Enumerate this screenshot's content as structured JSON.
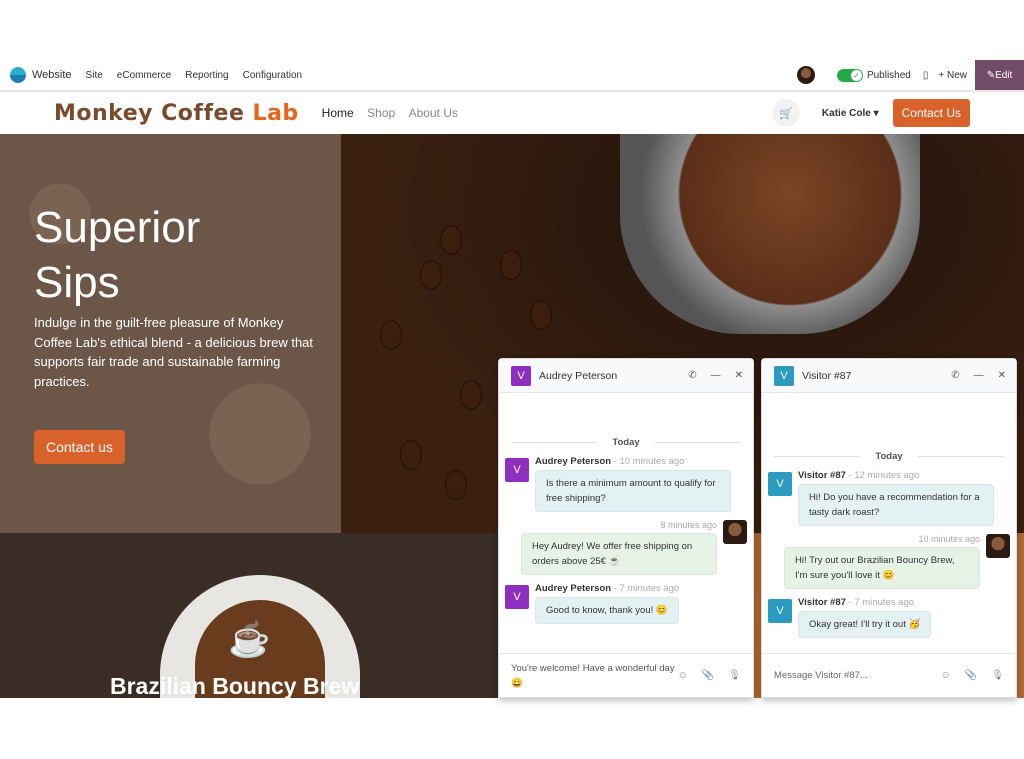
{
  "toolbar": {
    "app": "Website",
    "menu": [
      "Site",
      "eCommerce",
      "Reporting",
      "Configuration"
    ],
    "published": "Published",
    "new": "+ New",
    "edit": "Edit"
  },
  "site": {
    "brand_a": "Monkey ",
    "brand_b": "Coffee ",
    "brand_c": "Lab",
    "nav": [
      "Home",
      "Shop",
      "About Us"
    ],
    "user": "Katie Cole",
    "contact": "Contact Us"
  },
  "hero": {
    "title_1": "Superior",
    "title_2": "Sips",
    "text": "Indulge in the guilt-free pleasure of Monkey Coffee Lab's ethical blend - a delicious brew that supports fair trade and sustainable farming practices.",
    "button": "Contact us"
  },
  "product": {
    "title": "Brazilian Bouncy Brew"
  },
  "chat1": {
    "avatar": "V",
    "color": "#8e2fbf",
    "name": "Audrey Peterson",
    "today": "Today",
    "m1": {
      "who": "Audrey Peterson",
      "time": "- 10 minutes ago",
      "text": "Is there a minimum amount to qualify for free shipping?"
    },
    "m2": {
      "time": "8 minutes ago",
      "text": "Hey Audrey! We offer free shipping on orders above 25€ ☕"
    },
    "m3": {
      "who": "Audrey Peterson",
      "time": "- 7 minutes ago",
      "text": "Good to know, thank you! 😊"
    },
    "input": "You're welcome! Have a wonderful day 😀"
  },
  "chat2": {
    "avatar": "V",
    "color": "#2b9bbf",
    "name": "Visitor #87",
    "today": "Today",
    "m1": {
      "who": "Visitor #87",
      "time": "- 12 minutes ago",
      "text": "Hi! Do you have a recommendation for a tasty dark roast?"
    },
    "m2": {
      "time": "10 minutes ago",
      "text": "Hi! Try out our Brazilian Bouncy Brew, I'm sure you'll love it 😊"
    },
    "m3": {
      "who": "Visitor #87",
      "time": "- 7 minutes ago",
      "text": "Okay great! I'll try it out 🥳"
    },
    "placeholder": "Message Visitor #87..."
  }
}
